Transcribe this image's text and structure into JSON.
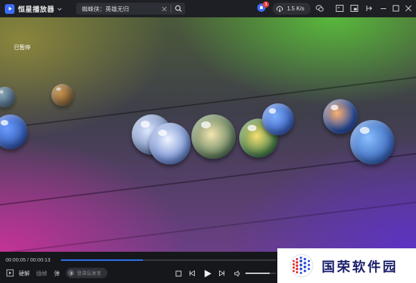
{
  "app": {
    "name": "恒星播放器",
    "search_text": "蜘蛛侠：英雄无归",
    "notification_count": "3",
    "download_speed": "1.5 K/s"
  },
  "video": {
    "overlay_text": "已暂停"
  },
  "controls": {
    "current_time": "00:00:05",
    "total_time": "00:00:13",
    "time_separator": "/",
    "progress_fraction": 0.38,
    "volume_fraction": 0.8,
    "decode_label": "硬解",
    "plugin_label": "插帧",
    "danmaku_label": "弹",
    "danmaku_placeholder": "登录后发言"
  },
  "watermark": {
    "text": "国荣软件园"
  },
  "colors": {
    "accent": "#2f78ff",
    "titlebar": "#1e1f24",
    "controlbar": "#16171b",
    "watermark_text": "#1a1f6b"
  }
}
